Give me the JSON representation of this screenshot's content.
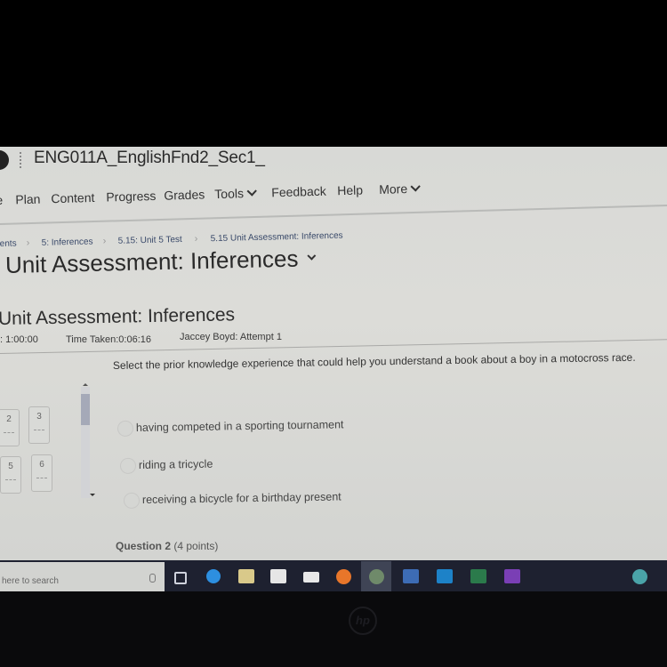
{
  "course": {
    "title": "ENG011A_EnglishFnd2_Sec1_"
  },
  "nav": {
    "items": [
      {
        "label": "e"
      },
      {
        "label": "Plan"
      },
      {
        "label": "Content"
      },
      {
        "label": "Progress"
      },
      {
        "label": "Grades"
      },
      {
        "label": "Tools",
        "dropdown": true
      },
      {
        "label": "Feedback"
      },
      {
        "label": "Help"
      },
      {
        "label": "More",
        "dropdown": true
      }
    ]
  },
  "breadcrumb": [
    {
      "label": "ents"
    },
    {
      "label": "5: Inferences"
    },
    {
      "label": "5.15: Unit 5 Test"
    },
    {
      "label": "5.15 Unit Assessment: Inferences"
    }
  ],
  "page": {
    "title": "Unit Assessment: Inferences"
  },
  "quiz": {
    "title": "Unit Assessment: Inferences",
    "time_limit": ": 1:00:00",
    "time_taken": "Time Taken:0:06:16",
    "attempt": "Jaccey Boyd: Attempt 1"
  },
  "question_nav": [
    {
      "number": "2"
    },
    {
      "number": "3"
    },
    {
      "number": "5"
    },
    {
      "number": "6"
    }
  ],
  "question1": {
    "text": "Select the prior knowledge experience that could help you understand a book about a boy in a motocross race.",
    "options": [
      {
        "label": "having competed in a sporting tournament",
        "selected": false
      },
      {
        "label": "riding a tricycle",
        "selected": false
      },
      {
        "label": "receiving a bicycle for a birthday present",
        "selected": false
      }
    ]
  },
  "question2": {
    "label": "Question 2",
    "points": "(4 points)"
  },
  "taskbar": {
    "search_placeholder": "here to search",
    "apps": [
      {
        "name": "task-view",
        "color": "#cfd2dc"
      },
      {
        "name": "edge",
        "color": "#2d8fe0"
      },
      {
        "name": "file-explorer",
        "color": "#d9c98a"
      },
      {
        "name": "store",
        "color": "#e6e6e6"
      },
      {
        "name": "mail",
        "color": "#e8e8e8"
      },
      {
        "name": "firefox",
        "color": "#e8762a"
      },
      {
        "name": "chrome",
        "color": "#6f8a6a",
        "active": true
      },
      {
        "name": "word",
        "color": "#3d6cb5"
      },
      {
        "name": "outlook",
        "color": "#1d82c8"
      },
      {
        "name": "excel",
        "color": "#2b7a4b"
      },
      {
        "name": "power-automate",
        "color": "#7a3fb5"
      },
      {
        "name": "help",
        "color": "#4aa3a8"
      }
    ]
  },
  "device": {
    "brand": "hp"
  }
}
